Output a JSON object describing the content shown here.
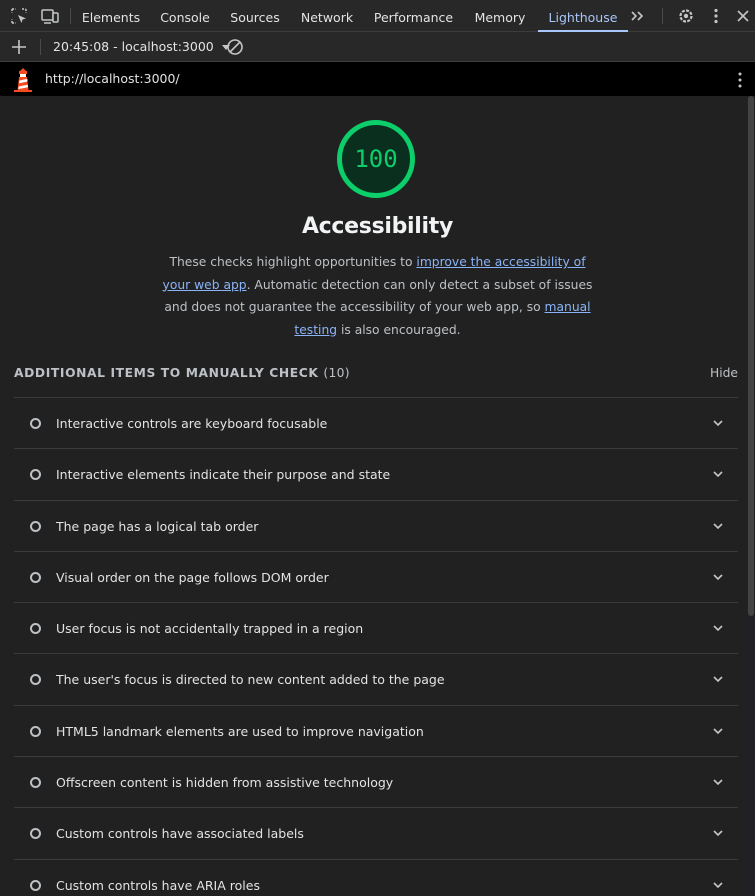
{
  "devtools": {
    "tabs": [
      {
        "label": "Elements"
      },
      {
        "label": "Console"
      },
      {
        "label": "Sources"
      },
      {
        "label": "Network"
      },
      {
        "label": "Performance"
      },
      {
        "label": "Memory"
      },
      {
        "label": "Lighthouse",
        "active": true
      }
    ],
    "overflow_icon": "chevron-double-right-icon",
    "settings_icon": "gear-icon",
    "menu_icon": "kebab-menu-icon"
  },
  "lighthouse_toolbar": {
    "report_label": "20:45:08 - localhost:3000"
  },
  "url_bar": {
    "url": "http://localhost:3000/"
  },
  "category": {
    "score": "100",
    "score_fraction": 1.0,
    "score_color": "#0cce6b",
    "title": "Accessibility",
    "desc_pre": "These checks highlight opportunities to ",
    "desc_link1": "improve the accessibility of your web app",
    "desc_mid": ". Automatic detection can only detect a subset of issues and does not guarantee the accessibility of your web app, so ",
    "desc_link2": "manual testing",
    "desc_post": " is also encouraged."
  },
  "manual_section": {
    "heading": "ADDITIONAL ITEMS TO MANUALLY CHECK",
    "count": "(10)",
    "hide_label": "Hide",
    "audits": [
      "Interactive controls are keyboard focusable",
      "Interactive elements indicate their purpose and state",
      "The page has a logical tab order",
      "Visual order on the page follows DOM order",
      "User focus is not accidentally trapped in a region",
      "The user's focus is directed to new content added to the page",
      "HTML5 landmark elements are used to improve navigation",
      "Offscreen content is hidden from assistive technology",
      "Custom controls have associated labels",
      "Custom controls have ARIA roles"
    ]
  }
}
